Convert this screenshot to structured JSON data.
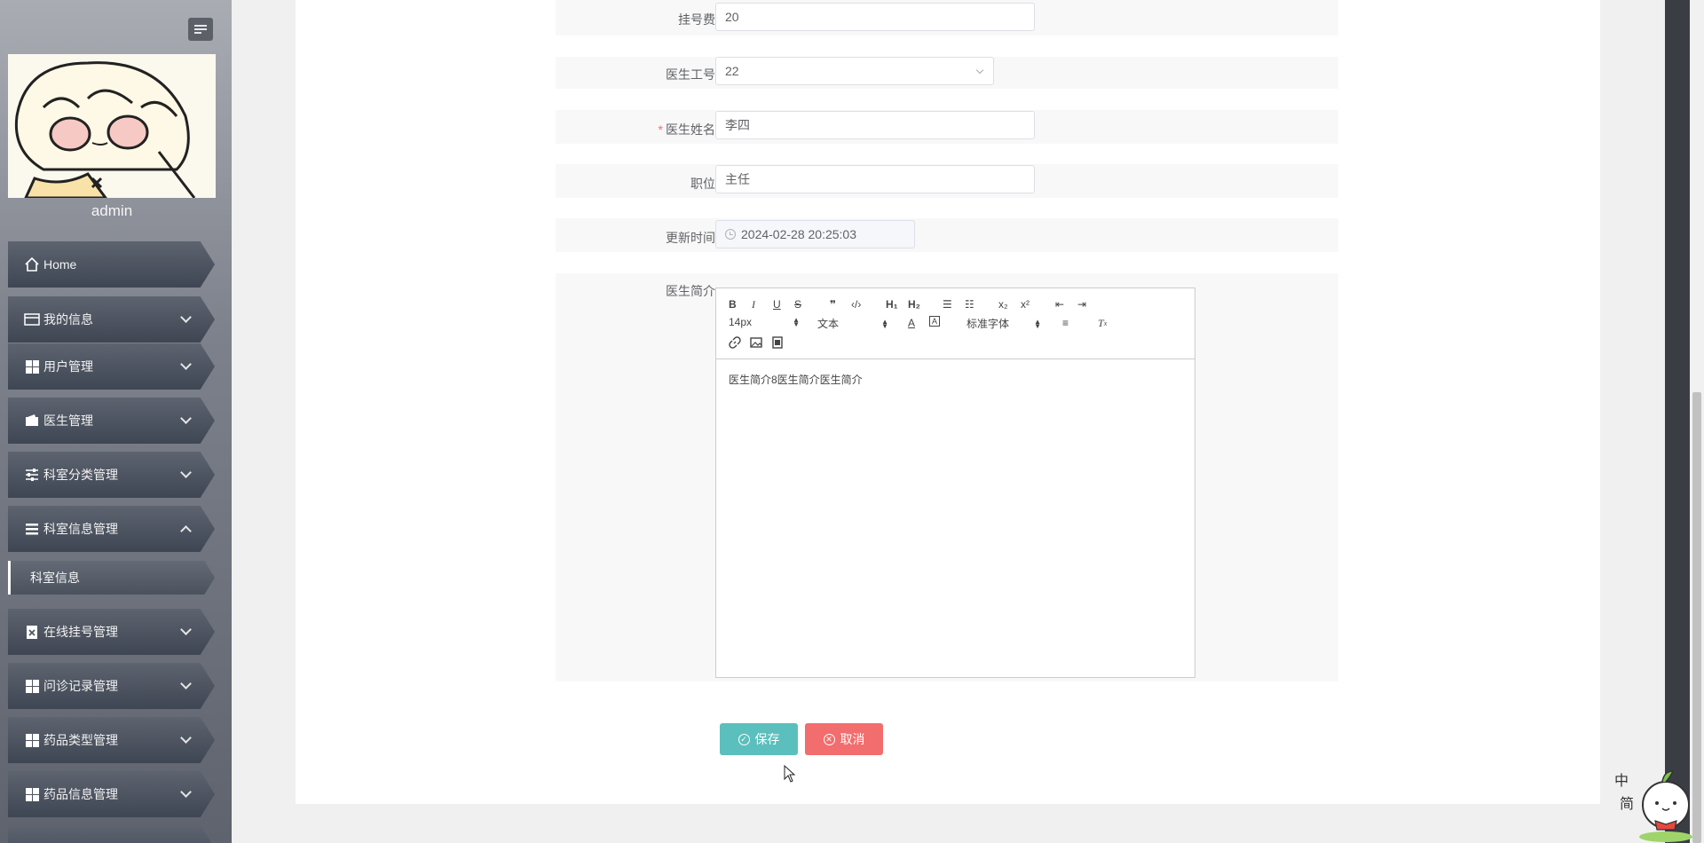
{
  "sidebar": {
    "username": "admin",
    "menu": [
      {
        "label": "Home",
        "icon": "home-icon"
      },
      {
        "label": "我的信息",
        "icon": "id-card-icon"
      },
      {
        "label": "用户管理",
        "icon": "grid-icon"
      },
      {
        "label": "医生管理",
        "icon": "wallet-icon"
      },
      {
        "label": "科室分类管理",
        "icon": "sliders-icon"
      },
      {
        "label": "科室信息管理",
        "icon": "list-icon"
      },
      {
        "label": "在线挂号管理",
        "icon": "clipboard-icon"
      },
      {
        "label": "问诊记录管理",
        "icon": "grid-icon"
      },
      {
        "label": "药品类型管理",
        "icon": "grid-icon"
      },
      {
        "label": "药品信息管理",
        "icon": "grid-icon"
      }
    ],
    "submenu": {
      "label": "科室信息"
    }
  },
  "form": {
    "fee": {
      "label": "挂号费",
      "value": "20"
    },
    "doctor_id": {
      "label": "医生工号",
      "value": "22"
    },
    "doctor_name": {
      "label": "医生姓名",
      "value": "李四",
      "required": true
    },
    "position": {
      "label": "职位",
      "value": "主任"
    },
    "updated": {
      "label": "更新时间",
      "value": "2024-02-28 20:25:03"
    },
    "intro": {
      "label": "医生简介",
      "content": "医生简介8医生简介医生简介"
    }
  },
  "editor": {
    "size_picker": "14px",
    "header_picker": "文本",
    "font_picker": "标准字体",
    "h1": "H₁",
    "h2": "H₂",
    "sub": "x₂",
    "sup": "x²"
  },
  "actions": {
    "save": "保存",
    "cancel": "取消"
  },
  "colors": {
    "save_button": "#5bbfbd",
    "cancel_button": "#f26d6d",
    "sidebar_item": "#4b525e"
  }
}
